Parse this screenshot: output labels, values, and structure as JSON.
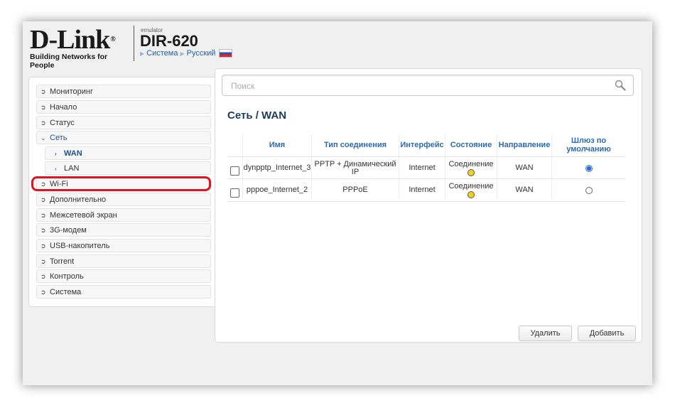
{
  "header": {
    "logo": "D-Link",
    "tagline": "Building Networks for People",
    "emulator_label": "emulator",
    "model": "DIR-620",
    "breadcrumb": [
      "Система",
      "Русский"
    ]
  },
  "sidebar": {
    "items": [
      {
        "label": "Мониторинг",
        "icon": "chevron-right-circle-icon"
      },
      {
        "label": "Начало",
        "icon": "chevron-right-circle-icon"
      },
      {
        "label": "Статус",
        "icon": "chevron-right-circle-icon"
      },
      {
        "label": "Сеть",
        "icon": "chevron-down-circle-icon"
      },
      {
        "label": "WAN",
        "icon": "chevron-right-icon"
      },
      {
        "label": "LAN",
        "icon": "chevron-right-icon"
      },
      {
        "label": "Wi-Fi",
        "icon": "chevron-right-circle-icon"
      },
      {
        "label": "Дополнительно",
        "icon": "chevron-right-circle-icon"
      },
      {
        "label": "Межсетевой экран",
        "icon": "chevron-right-circle-icon"
      },
      {
        "label": "3G-модем",
        "icon": "chevron-right-circle-icon"
      },
      {
        "label": "USB-накопитель",
        "icon": "chevron-right-circle-icon"
      },
      {
        "label": "Torrent",
        "icon": "chevron-right-circle-icon"
      },
      {
        "label": "Контроль",
        "icon": "chevron-right-circle-icon"
      },
      {
        "label": "Система",
        "icon": "chevron-right-circle-icon"
      }
    ],
    "highlight_color": "#e0141e"
  },
  "search": {
    "placeholder": "Поиск",
    "value": ""
  },
  "page": {
    "title": "Сеть /  WAN"
  },
  "table": {
    "columns": [
      "Имя",
      "Тип соединения",
      "Интерфейс",
      "Состояние",
      "Направление",
      "Шлюз по умолчанию"
    ],
    "rows": [
      {
        "name": "dynpptp_Internet_3",
        "type": "PPTP + Динамический IP",
        "interface": "Internet",
        "state": "Соединение",
        "direction": "WAN",
        "default_gateway": true
      },
      {
        "name": "pppoe_Internet_2",
        "type": "PPPoE",
        "interface": "Internet",
        "state": "Соединение",
        "direction": "WAN",
        "default_gateway": false
      }
    ]
  },
  "buttons": {
    "delete": "Удалить",
    "add": "Добавить"
  },
  "colors": {
    "accent": "#2a6bb3",
    "title": "#1a3a5e",
    "status_dot": "#f3d21f"
  }
}
